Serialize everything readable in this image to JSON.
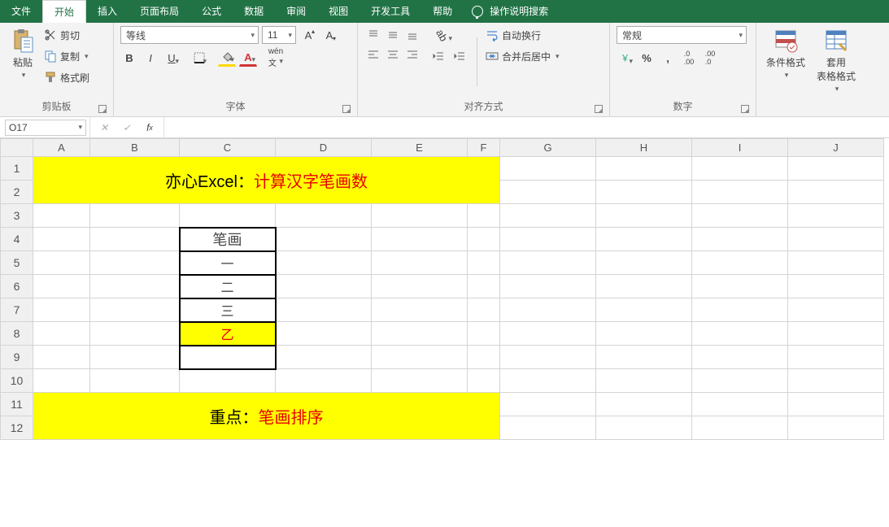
{
  "menu": {
    "file": "文件",
    "home": "开始",
    "insert": "插入",
    "layout": "页面布局",
    "formula": "公式",
    "data": "数据",
    "review": "审阅",
    "view": "视图",
    "dev": "开发工具",
    "help": "帮助",
    "search": "操作说明搜索"
  },
  "ribbon": {
    "clipboard": {
      "title": "剪贴板",
      "paste": "粘贴",
      "cut": "剪切",
      "copy": "复制",
      "painter": "格式刷"
    },
    "font": {
      "title": "字体",
      "name": "等线",
      "size": "11"
    },
    "align": {
      "title": "对齐方式",
      "wrap": "自动换行",
      "merge": "合并后居中"
    },
    "number": {
      "title": "数字",
      "format": "常规"
    },
    "styles": {
      "cond": "条件格式",
      "table": "套用\n表格格式"
    }
  },
  "fbar": {
    "cell": "O17",
    "fx": ""
  },
  "cols": [
    "A",
    "B",
    "C",
    "D",
    "E",
    "F",
    "G",
    "H",
    "I",
    "J"
  ],
  "rows": [
    "1",
    "2",
    "3",
    "4",
    "5",
    "6",
    "7",
    "8",
    "9",
    "10",
    "11",
    "12"
  ],
  "banner1": {
    "a": "亦心Excel：",
    "b": "计算汉字笔画数"
  },
  "tbl": {
    "header": "笔画",
    "r1": "一",
    "r2": "二",
    "r3": "三",
    "r4": "乙",
    "r5": ""
  },
  "banner2": {
    "a": "重点：",
    "b": "笔画排序"
  }
}
